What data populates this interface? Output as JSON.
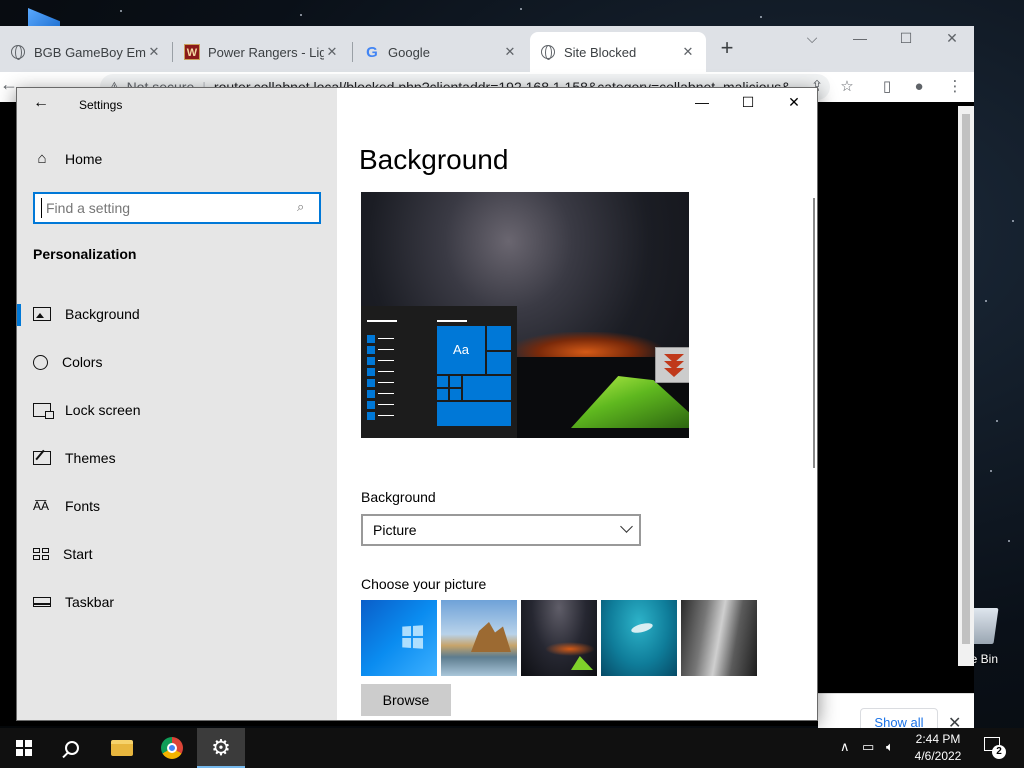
{
  "browser": {
    "tabs": [
      {
        "title": "BGB GameBoy Emulat",
        "icon": "globe-icon",
        "active": false
      },
      {
        "title": "Power Rangers - Ligh",
        "icon": "w-favicon",
        "active": false
      },
      {
        "title": "Google",
        "icon": "google-icon",
        "active": false
      },
      {
        "title": "Site Blocked",
        "icon": "globe-icon",
        "active": true
      }
    ],
    "tab_close": "✕",
    "new_tab": "+",
    "address": {
      "security": "Not secure",
      "url": "router.collabnet.local/blocked.php?clientaddr=192.168.1.158&category=collabnet_malicious&"
    },
    "download_bar": {
      "show_all": "Show all"
    }
  },
  "settings": {
    "window_title": "Settings",
    "home": "Home",
    "search": {
      "placeholder": "Find a setting"
    },
    "section": "Personalization",
    "nav": [
      {
        "label": "Background",
        "icon": "picture-icon",
        "active": true
      },
      {
        "label": "Colors",
        "icon": "palette-icon",
        "active": false
      },
      {
        "label": "Lock screen",
        "icon": "lock-screen-icon",
        "active": false
      },
      {
        "label": "Themes",
        "icon": "themes-icon",
        "active": false
      },
      {
        "label": "Fonts",
        "icon": "fonts-icon",
        "active": false
      },
      {
        "label": "Start",
        "icon": "start-icon",
        "active": false
      },
      {
        "label": "Taskbar",
        "icon": "taskbar-icon",
        "active": false
      }
    ],
    "page_title": "Background",
    "preview_tile_text": "Aa",
    "background_label": "Background",
    "background_value": "Picture",
    "choose_label": "Choose your picture",
    "browse": "Browse",
    "accent_color": "#0078d7"
  },
  "desktop": {
    "recycle_bin_label": "le Bin"
  },
  "taskbar": {
    "time": "2:44 PM",
    "date": "4/6/2022",
    "notification_count": "2"
  }
}
